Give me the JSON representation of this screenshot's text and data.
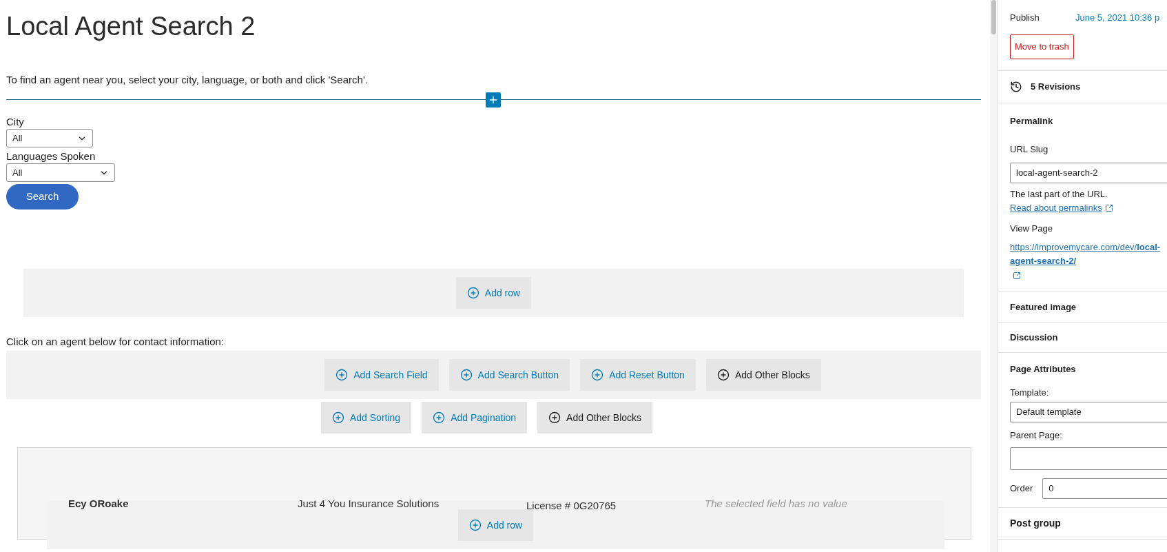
{
  "editor": {
    "title": "Local Agent Search 2",
    "intro": "To find an agent near you, select your city, language, or both and click 'Search'.",
    "fields": [
      {
        "label": "City",
        "value": "All"
      },
      {
        "label": "Languages Spoken",
        "value": "All"
      }
    ],
    "search_button": "Search",
    "add_row_button": "Add row",
    "list_intro": "Click on an agent below for contact information:",
    "search_toolbar": [
      {
        "label": "Add Search Field",
        "kind": "add"
      },
      {
        "label": "Add Search Button",
        "kind": "add"
      },
      {
        "label": "Add Reset Button",
        "kind": "add"
      },
      {
        "label": "Add Other Blocks",
        "kind": "other"
      }
    ],
    "results_toolbar": [
      {
        "label": "Add Sorting",
        "kind": "add"
      },
      {
        "label": "Add Pagination",
        "kind": "add"
      },
      {
        "label": "Add Other Blocks",
        "kind": "other"
      }
    ],
    "result_card": {
      "name": "Ecy ORoake",
      "company": "Just 4 You Insurance Solutions",
      "license": "License # 0G20765",
      "empty_field": "The selected field has no value",
      "add_row_button": "Add row"
    }
  },
  "sidebar": {
    "publish_label": "Publish",
    "publish_date": "June 5, 2021 10:36 p",
    "trash_button": "Move to trash",
    "revisions": "5 Revisions",
    "permalink": {
      "heading": "Permalink",
      "slug_label": "URL Slug",
      "slug_value": "local-agent-search-2",
      "help_text": "The last part of the URL.",
      "help_link": "Read about permalinks",
      "view_label": "View Page",
      "view_link": "https://improvemycare.com/dev/**local-agent-search-2/**"
    },
    "panels": [
      "Featured image",
      "Discussion"
    ],
    "page_attributes": {
      "heading": "Page Attributes",
      "template_label": "Template:",
      "template_value": "Default template",
      "parent_label": "Parent Page:",
      "order_label": "Order",
      "order_value": "0"
    },
    "post_group": "Post group"
  }
}
